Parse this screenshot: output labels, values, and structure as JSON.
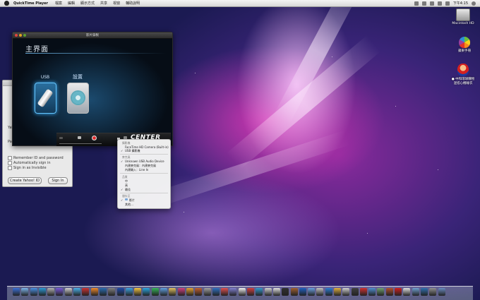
{
  "menubar": {
    "app_name": "QuickTime Player",
    "items": [
      "檔案",
      "編輯",
      "顯示方式",
      "共享",
      "視窗",
      "輔助說明"
    ],
    "clock": "下午4:15"
  },
  "desktop_icons": [
    {
      "label": "Macintosh HD",
      "icon": "hard-drive-icon"
    },
    {
      "label": "蘋果手冊",
      "icon": "apple-manual-icon"
    },
    {
      "label": "● 中和環球購物\n混搭心機睡衣",
      "icon": "mario-icon"
    }
  ],
  "chat_window": {
    "labels": [
      "Yah",
      "Pas"
    ],
    "checkboxes": [
      "Remember ID and password",
      "Automatically sign in",
      "Sign in as Invisible"
    ],
    "create_button": "Create Yahoo! ID",
    "signin_button": "Sign In"
  },
  "player": {
    "window_title": "影片錄製",
    "main_title": "主界面",
    "tiles": [
      {
        "label": "USB",
        "icon": "usb-stick-icon"
      },
      {
        "label": "設置",
        "icon": "gear-icon"
      }
    ],
    "logo": "CENTER"
  },
  "dropdown": {
    "sections": [
      {
        "header": "攝影機",
        "items": [
          {
            "label": "FaceTime HD Camera (Built-in)",
            "checked": false
          },
          {
            "label": "USB 攝影機",
            "checked": true
          }
        ]
      },
      {
        "header": "麥克風",
        "items": [
          {
            "label": "Unknown USB Audio Device",
            "checked": true
          },
          {
            "label": "內建麥克風：內建麥克風",
            "checked": false
          },
          {
            "label": "內建輸入：Line In",
            "checked": false
          }
        ]
      },
      {
        "header": "品質",
        "items": [
          {
            "label": "中",
            "checked": false
          },
          {
            "label": "高",
            "checked": false
          },
          {
            "label": "最佳",
            "checked": true
          }
        ]
      },
      {
        "header": "儲存至",
        "items": [
          {
            "label": "影片",
            "checked": true
          },
          {
            "label": "其他…",
            "checked": false
          }
        ]
      }
    ]
  },
  "dock": {
    "colors": [
      "#3b6fd6",
      "#7db4ea",
      "#4a90e2",
      "#2d9ad6",
      "#b0b0b0",
      "#7a5ad8",
      "#d0d0d0",
      "#4ab0e8",
      "#cc3333",
      "#f08a2a",
      "#2b6cb0",
      "#808080",
      "#1e4aa8",
      "#3da2e0",
      "#f4c542",
      "#2aa6e0",
      "#36b65a",
      "#60a0e0",
      "#e0c060",
      "#d04080",
      "#e0a030",
      "#c06030",
      "#a0a0a0",
      "#3070c0",
      "#e05050",
      "#8080d0",
      "#f0f0f0",
      "#d04040",
      "#3399cc",
      "#d0d0d0",
      "#e0e0e0",
      "#303030",
      "#a06030",
      "#2060c0",
      "#6aa0e0",
      "#c0c0c0",
      "#2d7dd2",
      "#e0b040",
      "#d0d0d0",
      "#404040",
      "#d03030",
      "#5090d0",
      "#70a070",
      "#b05030",
      "#d02020",
      "#e0e0e0",
      "#70a0d0",
      "#3070b0",
      "#909090",
      "#6a8cc0"
    ]
  }
}
